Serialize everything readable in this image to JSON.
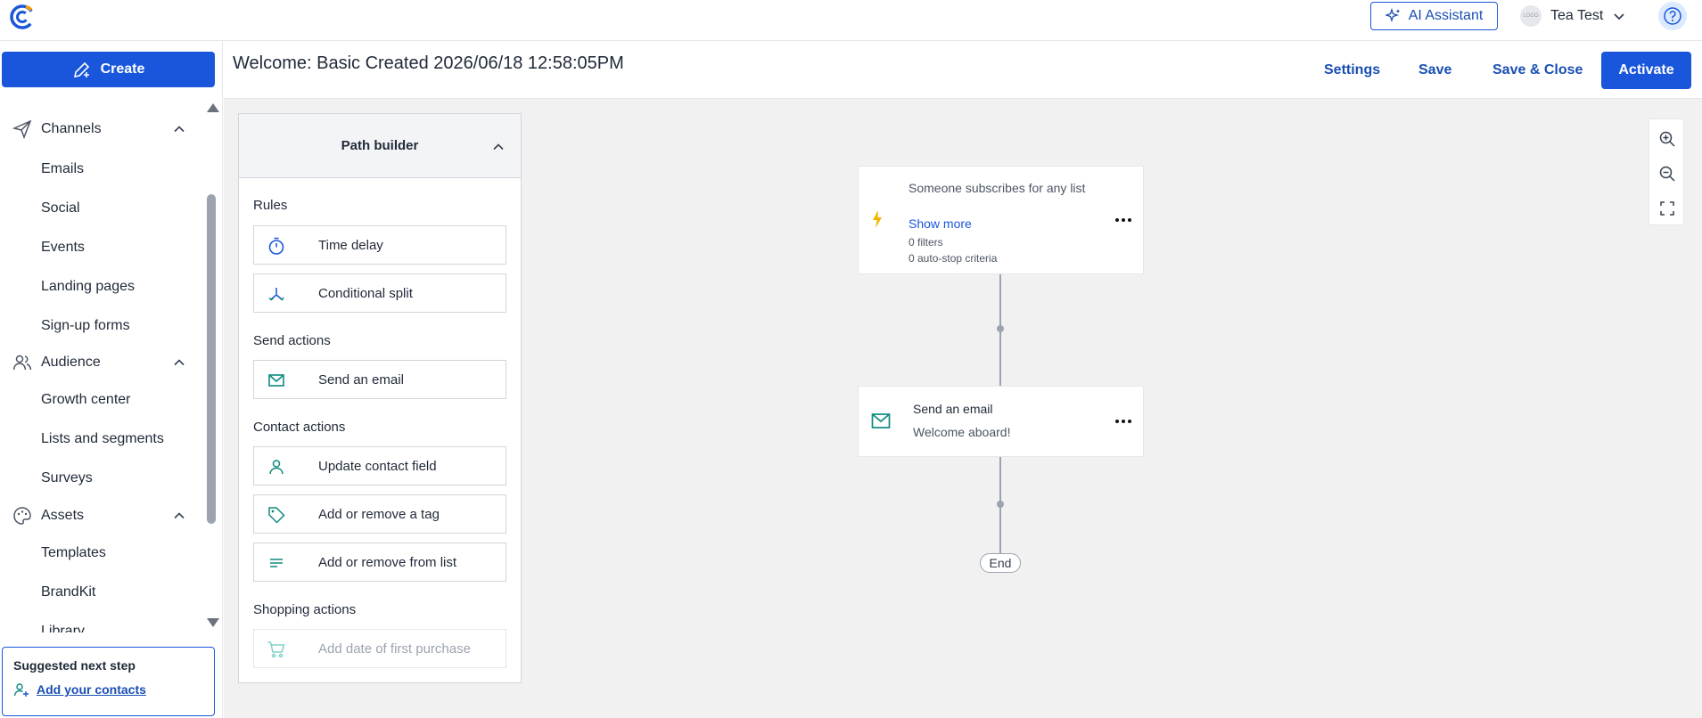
{
  "topbar": {
    "ai_assistant_label": "AI Assistant",
    "account_logo_text": "LOGO",
    "account_name": "Tea Test"
  },
  "sidebar": {
    "create_label": "Create",
    "groups": [
      {
        "label": "Channels",
        "items": [
          "Emails",
          "Social",
          "Events",
          "Landing pages",
          "Sign-up forms"
        ]
      },
      {
        "label": "Audience",
        "items": [
          "Growth center",
          "Lists and segments",
          "Surveys"
        ]
      },
      {
        "label": "Assets",
        "items": [
          "Templates",
          "BrandKit",
          "Library"
        ]
      }
    ],
    "suggestion": {
      "title": "Suggested next step",
      "link": "Add your contacts"
    }
  },
  "header": {
    "title": "Welcome: Basic Created 2026/06/18 12:58:05PM",
    "settings": "Settings",
    "save": "Save",
    "save_close": "Save & Close",
    "activate": "Activate"
  },
  "path_builder": {
    "title": "Path builder",
    "sections": {
      "rules": "Rules",
      "send_actions": "Send actions",
      "contact_actions": "Contact actions",
      "shopping_actions": "Shopping actions"
    },
    "actions": {
      "time_delay": "Time delay",
      "conditional_split": "Conditional split",
      "send_email": "Send an email",
      "update_contact": "Update contact field",
      "tag": "Add or remove a tag",
      "list": "Add or remove from list",
      "first_purchase": "Add date of first purchase"
    }
  },
  "flow": {
    "trigger": {
      "title": "Someone subscribes for any list",
      "show_more": "Show more",
      "filters": "0 filters",
      "auto_stop": "0 auto-stop criteria"
    },
    "email": {
      "title": "Send an email",
      "subject": "Welcome aboard!"
    },
    "end_label": "End"
  },
  "colors": {
    "primary": "#1a56db",
    "link": "#1a4fb3",
    "trigger_icon": "#f5b301",
    "email_icon": "#0f8a7e"
  }
}
